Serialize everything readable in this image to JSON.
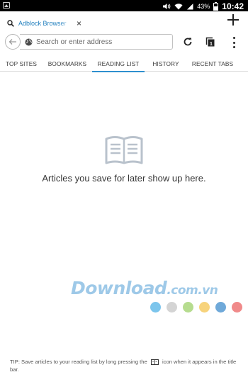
{
  "status_bar": {
    "battery_pct": "43%",
    "time": "10:42"
  },
  "tab": {
    "title": "Adblock Browser",
    "close_glyph": "×"
  },
  "url_bar": {
    "placeholder": "Search or enter address"
  },
  "panel_tabs": [
    "TOP SITES",
    "BOOKMARKS",
    "READING LIST",
    "HISTORY",
    "RECENT TABS"
  ],
  "active_panel": "READING LIST",
  "empty_state": {
    "message": "Articles you save for later show up here."
  },
  "watermark": {
    "brand": "Download",
    "domain": ".com.vn",
    "dot_colors": [
      "#7cc5ec",
      "#d4d4d4",
      "#b6dc8f",
      "#f7d37c",
      "#6fa9d9",
      "#f08a8a"
    ]
  },
  "tip": {
    "before_icon": "TIP: Save articles to your reading list by long pressing the",
    "after_icon": "icon when it appears in the title bar."
  },
  "colors": {
    "accent": "#2e8fcf",
    "tab_title": "#1f7ebd"
  },
  "icons": {
    "back": "back-arrow-icon",
    "globe": "globe-icon",
    "reload": "reload-icon",
    "tabs": "tabs-counter-icon",
    "menu": "overflow-menu-icon",
    "empty": "reading-list-book-icon"
  }
}
